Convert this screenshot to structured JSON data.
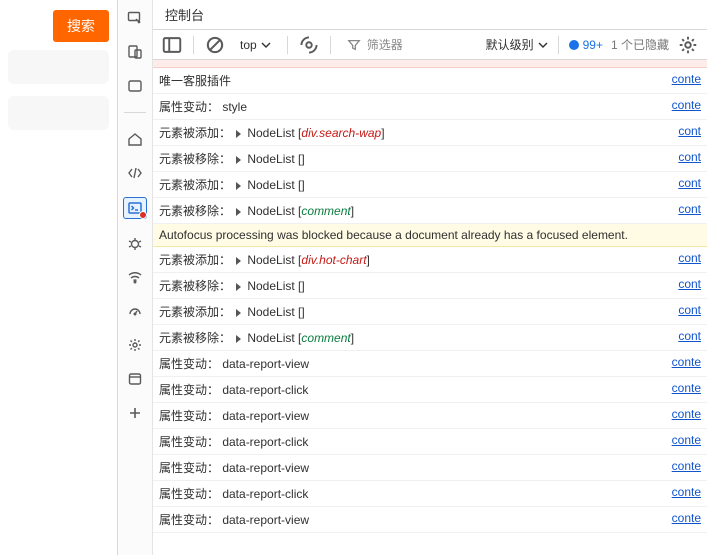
{
  "page": {
    "search_label": "搜索"
  },
  "tab": {
    "title": "控制台"
  },
  "toolbar": {
    "context": "top",
    "filter_placeholder": "筛选器",
    "level": "默认级别",
    "live_count": "99+",
    "hidden_text": "1 个已隐藏"
  },
  "tokens": {
    "nodelist": "NodeList",
    "added": "元素被添加：",
    "removed": "元素被移除：",
    "attr": "属性变动：",
    "src_conte": "conte",
    "src_cont": "cont"
  },
  "logs": [
    {
      "type": "plain",
      "text": "唯一客服插件",
      "src": "conte"
    },
    {
      "type": "attr",
      "attr": "style",
      "src": "conte"
    },
    {
      "type": "added",
      "token_kind": "sel",
      "token": "div.search-wap",
      "src": "cont"
    },
    {
      "type": "removed",
      "token_kind": "none",
      "src": "cont"
    },
    {
      "type": "added",
      "token_kind": "none",
      "src": "cont"
    },
    {
      "type": "removed",
      "token_kind": "cmt",
      "token": "comment",
      "src": "cont"
    },
    {
      "type": "warn",
      "text": "Autofocus processing was blocked because a document already has a focused element."
    },
    {
      "type": "added",
      "token_kind": "sel",
      "token": "div.hot-chart",
      "src": "cont"
    },
    {
      "type": "removed",
      "token_kind": "none",
      "src": "cont"
    },
    {
      "type": "added",
      "token_kind": "none",
      "src": "cont"
    },
    {
      "type": "removed",
      "token_kind": "cmt",
      "token": "comment",
      "src": "cont"
    },
    {
      "type": "attr",
      "attr": "data-report-view",
      "src": "conte"
    },
    {
      "type": "attr",
      "attr": "data-report-click",
      "src": "conte"
    },
    {
      "type": "attr",
      "attr": "data-report-view",
      "src": "conte"
    },
    {
      "type": "attr",
      "attr": "data-report-click",
      "src": "conte"
    },
    {
      "type": "attr",
      "attr": "data-report-view",
      "src": "conte"
    },
    {
      "type": "attr",
      "attr": "data-report-click",
      "src": "conte"
    },
    {
      "type": "attr",
      "attr": "data-report-view",
      "src": "conte"
    }
  ]
}
